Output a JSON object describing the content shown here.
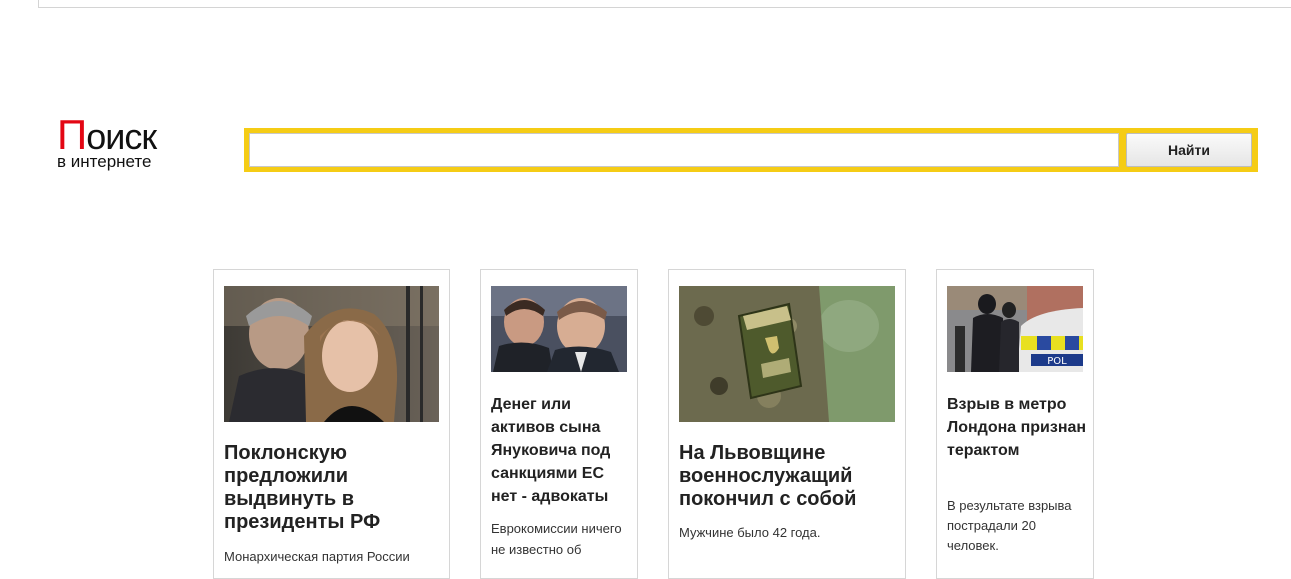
{
  "logo": {
    "first_letter": "П",
    "rest": "оиск",
    "subtitle": "в интернете"
  },
  "search": {
    "value": "",
    "placeholder": "",
    "button_label": "Найти",
    "frame_color": "#f5cc15"
  },
  "news": [
    {
      "image": "photo-woman-and-man",
      "headline": "Поклонскую предложили выдвинуть в президенты РФ",
      "summary": "Монархическая партия России"
    },
    {
      "image": "photo-two-men",
      "headline": "Денег или активов сына Януковича под санкциями ЕС нет - адвокаты",
      "summary": "Еврокомиссии ничего не известно об"
    },
    {
      "image": "photo-military-patch",
      "headline": "На Львовщине военнослужащий покончил с собой",
      "summary": "Мужчине было 42 года."
    },
    {
      "image": "photo-police-car",
      "headline": "Взрыв в метро Лондона признан терактом",
      "summary": "В результате взрыва пострадали 20 человек."
    }
  ]
}
